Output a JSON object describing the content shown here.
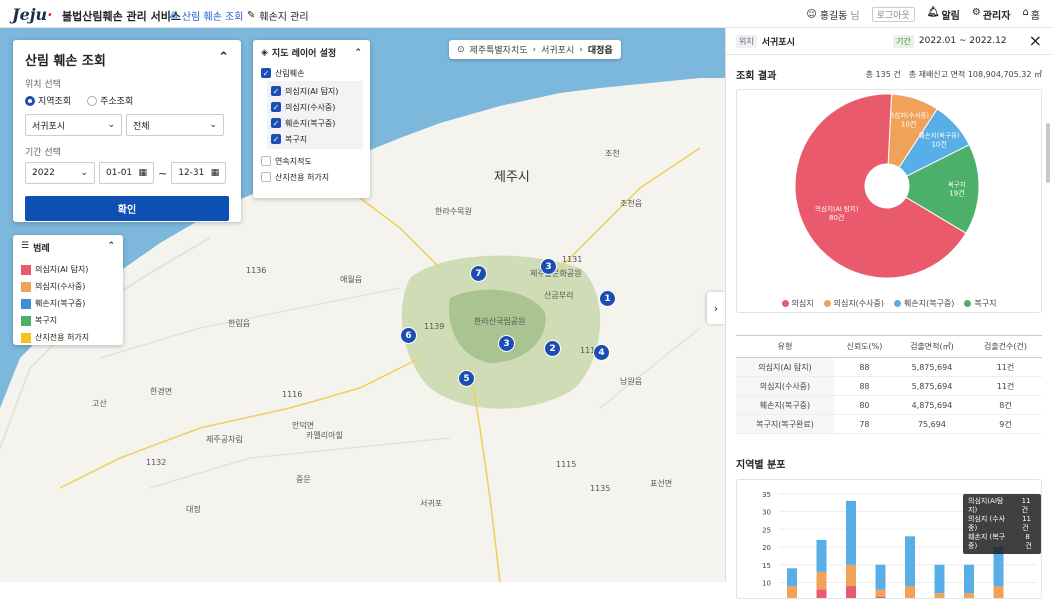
{
  "header": {
    "logo": "Jeju",
    "service_name": "불법산림훼손 관리 서비스",
    "nav": [
      {
        "label": "산림 훼손 조회",
        "icon": "map-icon",
        "active": true
      },
      {
        "label": "훼손지 관리",
        "icon": "edit-icon",
        "active": false
      }
    ],
    "user": "홍길동",
    "user_suffix": "님",
    "logout": "로그아웃",
    "alarm": "알림",
    "admin": "관리자",
    "home": "홈"
  },
  "breadcrumb": [
    "제주특별자치도",
    "서귀포시",
    "대정읍"
  ],
  "search": {
    "title": "산림 훼손 조회",
    "location_label": "위치 선택",
    "radio": [
      "지역조회",
      "주소조회"
    ],
    "radio_selected": "지역조회",
    "city": "서귀포시",
    "district": "전체",
    "period_label": "기간 선택",
    "year": "2022",
    "from": "01-01",
    "tilde": "~",
    "to": "12-31",
    "confirm": "확인"
  },
  "layers": {
    "title": "지도 레이어 설정",
    "group": {
      "label": "산림훼손",
      "checked": true
    },
    "items": [
      {
        "label": "의심지(AI 탐지)",
        "checked": true
      },
      {
        "label": "의심지(수사중)",
        "checked": true
      },
      {
        "label": "훼손지(복구중)",
        "checked": true
      },
      {
        "label": "복구지",
        "checked": true
      }
    ],
    "extra": [
      {
        "label": "연속지적도",
        "checked": false
      },
      {
        "label": "산지전용 허가지",
        "checked": false
      }
    ]
  },
  "legend": {
    "title": "범례",
    "items": [
      {
        "label": "의심지(AI 탐지)",
        "color": "#e85a6c"
      },
      {
        "label": "의심지(수사중)",
        "color": "#f1a25a"
      },
      {
        "label": "훼손지(복구중)",
        "color": "#3d8fd6"
      },
      {
        "label": "복구지",
        "color": "#4caf6a"
      },
      {
        "label": "산지전용 허가지",
        "color": "#f4c21b"
      }
    ]
  },
  "map": {
    "city_label": "제주시",
    "markers": [
      {
        "n": "1"
      },
      {
        "n": "2"
      },
      {
        "n": "3"
      },
      {
        "n": "3"
      },
      {
        "n": "4"
      },
      {
        "n": "5"
      },
      {
        "n": "6"
      },
      {
        "n": "7"
      }
    ],
    "place_labels": [
      "한라수목원",
      "한라산국립공원",
      "애월읍",
      "한림읍",
      "조천읍",
      "남원읍",
      "안덕면",
      "한경면",
      "표선면",
      "제주공자림",
      "카멜리아힐",
      "제주돌문화공원",
      "산굼부리",
      "조천",
      "1131",
      "1139",
      "1116",
      "1132",
      "1136",
      "1118",
      "1135",
      "1115",
      "중문",
      "고산",
      "대정",
      "서귀포"
    ]
  },
  "result": {
    "loc_tag": "위치",
    "loc": "서귀포시",
    "period_tag": "기간",
    "period": "2022.01 ~ 2022.12",
    "title": "조회 결과",
    "total": "총 135 건",
    "area": "총 재배신고 면적 108,904,705.32 ㎡",
    "pie_labels": [
      {
        "name": "의심지(AI 탐지)",
        "value": "80건"
      },
      {
        "name": "의심지(수사중)",
        "value": "10건"
      },
      {
        "name": "훼손지(복구중)",
        "value": "10건"
      },
      {
        "name": "복구지",
        "value": "19건"
      }
    ],
    "pie_legend": [
      "의심지",
      "의심지(수사중)",
      "훼손지(복구중)",
      "복구지"
    ],
    "table": {
      "headers": [
        "유형",
        "신뢰도(%)",
        "검출면적(㎡)",
        "검출건수(건)"
      ],
      "rows": [
        [
          "의심지(AI 탐지)",
          "88",
          "5,875,694",
          "11건"
        ],
        [
          "의심지(수사중)",
          "88",
          "5,875,694",
          "11건"
        ],
        [
          "훼손지(복구중)",
          "80",
          "4,875,694",
          "8건"
        ],
        [
          "복구지(복구완료)",
          "78",
          "75,694",
          "9건"
        ]
      ]
    },
    "region_title": "지역별 분포",
    "tooltip": [
      [
        "의심지(AI탐지)",
        "11건"
      ],
      [
        "의심지 (수사중)",
        "11건"
      ],
      [
        "훼손지 (복구중)",
        "8건"
      ]
    ]
  },
  "chart_data": [
    {
      "type": "pie",
      "title": "",
      "categories": [
        "의심지(AI 탐지)",
        "의심지(수사중)",
        "훼손지(복구중)",
        "복구지"
      ],
      "values": [
        80,
        10,
        10,
        19
      ],
      "colors": [
        "#e85a6c",
        "#f1a25a",
        "#58aee6",
        "#4caf6a"
      ]
    },
    {
      "type": "bar",
      "stacked": true,
      "title": "지역별 분포",
      "ylim": [
        0,
        35
      ],
      "yticks": [
        10,
        15,
        20,
        25,
        30,
        35
      ],
      "categories": [
        "",
        "",
        "",
        "",
        "",
        "",
        "",
        ""
      ],
      "series": [
        {
          "name": "의심지(AI 탐지)",
          "color": "#e85a6c",
          "values": [
            5,
            8,
            9,
            6,
            5,
            4,
            4,
            5
          ]
        },
        {
          "name": "의심지(수사중)",
          "color": "#f1a25a",
          "values": [
            4,
            5,
            6,
            2,
            4,
            3,
            3,
            4
          ]
        },
        {
          "name": "훼손지(복구중)",
          "color": "#58aee6",
          "values": [
            5,
            9,
            18,
            7,
            14,
            8,
            8,
            11
          ]
        }
      ]
    }
  ]
}
